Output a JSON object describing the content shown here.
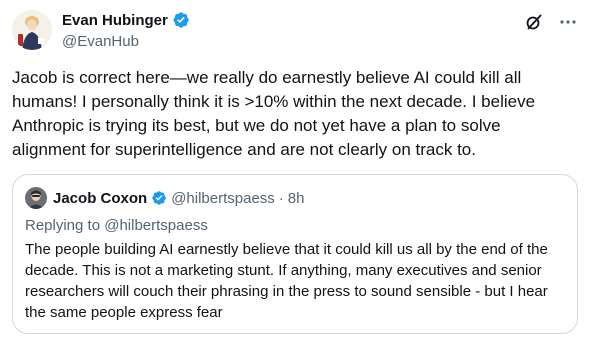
{
  "author": {
    "name": "Evan Hubinger",
    "handle": "@EvanHub"
  },
  "tweet_text": "Jacob is correct here—we really do earnestly believe AI could kill all humans! I personally think it is >10% within the next decade. I believe Anthropic is trying its best, but we do not yet have a plan to solve alignment for superintelligence and are not clearly on track to.",
  "quoted": {
    "name": "Jacob Coxon",
    "handle": "@hilbertspaess",
    "separator": "·",
    "time": "8h",
    "replying_prefix": "Replying to",
    "replying_handle": "@hilbertspaess",
    "text": "The people building AI earnestly believe that it could kill us all by the end of the decade. This is not a marketing stunt. If anything, many executives and senior researchers will couch their phrasing in the press to sound sensible - but I hear the same people express fear"
  },
  "icons": {
    "verified": "verified-badge-icon",
    "grok": "grok-icon",
    "more": "more-icon"
  },
  "colors": {
    "verified_blue": "#1d9bf0",
    "text_primary": "#0f1419",
    "text_secondary": "#536471",
    "border": "#cfd9de"
  }
}
